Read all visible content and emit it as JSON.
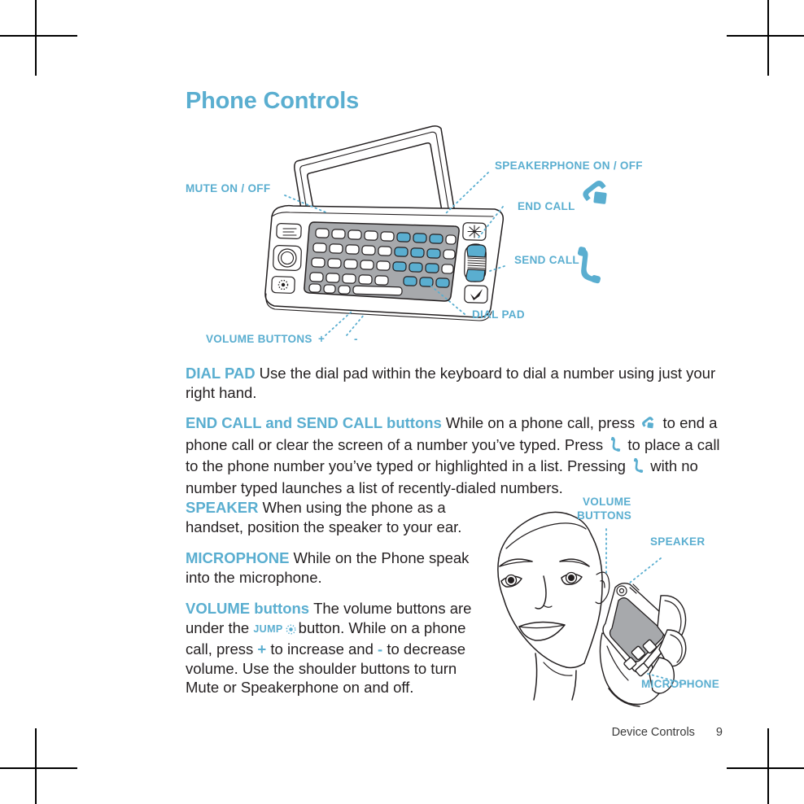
{
  "title": "Phone Controls",
  "colors": {
    "accent": "#5aaed0",
    "text": "#231f20",
    "keypad_fill": "#a7a9ac",
    "key_blue": "#5aaed0",
    "outline": "#231f20"
  },
  "device_diagram": {
    "labels": {
      "mute": "MUTE ON / OFF",
      "speakerphone": "SPEAKERPHONE ON / OFF",
      "end_call": "END CALL",
      "send_call": "SEND CALL",
      "dial_pad": "DIAL PAD",
      "volume_buttons": "VOLUME BUTTONS",
      "volume_plus": "+",
      "volume_minus": "-"
    },
    "icons": {
      "end_call": "end-call-handset-icon",
      "send_call": "send-call-handset-icon"
    }
  },
  "paragraphs": [
    {
      "id": "dial-pad",
      "lead": "DIAL PAD",
      "body": "Use the dial pad within the keyboard to dial a number using just your right hand."
    },
    {
      "id": "end-send-call",
      "lead": "END CALL and SEND CALL buttons",
      "body_1": "While on a phone call, press",
      "body_2": "to end a phone call or clear the screen of a number you’ve typed. Press",
      "body_3": "to place a call to the phone number you’ve typed or highlighted in a list. Pressing",
      "body_4": "with no number typed launches a list of recently-dialed numbers."
    },
    {
      "id": "speaker",
      "lead": "SPEAKER",
      "body": "When using the phone as a handset, position the speaker to your ear."
    },
    {
      "id": "microphone",
      "lead": "MICROPHONE",
      "body": "While on the Phone speak into the microphone."
    },
    {
      "id": "volume-buttons",
      "lead": "VOLUME buttons",
      "body_1": "The volume buttons are under the",
      "jump_label": "JUMP",
      "body_2": "button. While on a phone call, press",
      "plus": "+",
      "body_3": "to increase and",
      "minus": "-",
      "body_4": "to decrease volume. Use the shoulder buttons to turn Mute or Speakerphone on and off."
    }
  ],
  "person_diagram": {
    "labels": {
      "volume_line1": "VOLUME",
      "volume_line2": "BUTTONS",
      "speaker": "SPEAKER",
      "microphone": "MICROPHONE"
    }
  },
  "footer": {
    "section": "Device Controls",
    "page": "9"
  }
}
